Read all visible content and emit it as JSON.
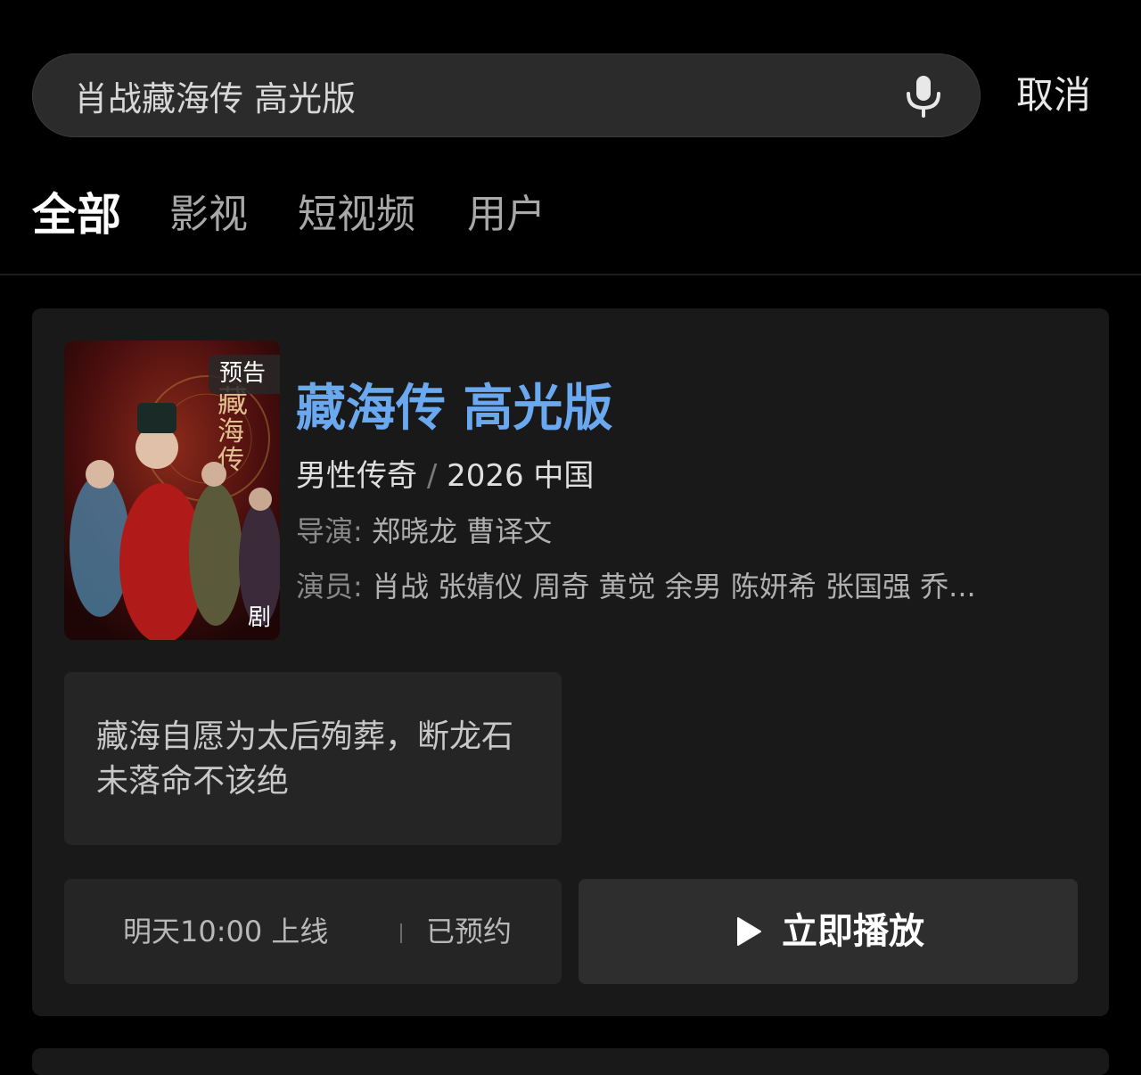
{
  "search": {
    "query": "肖战藏海传 高光版",
    "cancel_label": "取消"
  },
  "tabs": [
    {
      "label": "全部",
      "active": true
    },
    {
      "label": "影视",
      "active": false
    },
    {
      "label": "短视频",
      "active": false
    },
    {
      "label": "用户",
      "active": false
    }
  ],
  "result": {
    "poster": {
      "badge": "预告",
      "corner_label": "剧"
    },
    "title": "藏海传 高光版",
    "genre": "男性传奇",
    "separator": "/",
    "year_region": "2026 中国",
    "director_label": "导演:",
    "directors": "郑晓龙 曹译文",
    "cast_label": "演员:",
    "cast": "肖战 张婧仪 周奇 黄觉 余男 陈妍希 张国强 乔...",
    "highlight": "藏海自愿为太后殉葬，断龙石未落命不该绝",
    "schedule": "明天10:00 上线",
    "reserved_label": "已预约",
    "play_label": "立即播放"
  },
  "colors": {
    "background": "#000000",
    "card": "#191919",
    "title_link": "#6aa8f0"
  }
}
